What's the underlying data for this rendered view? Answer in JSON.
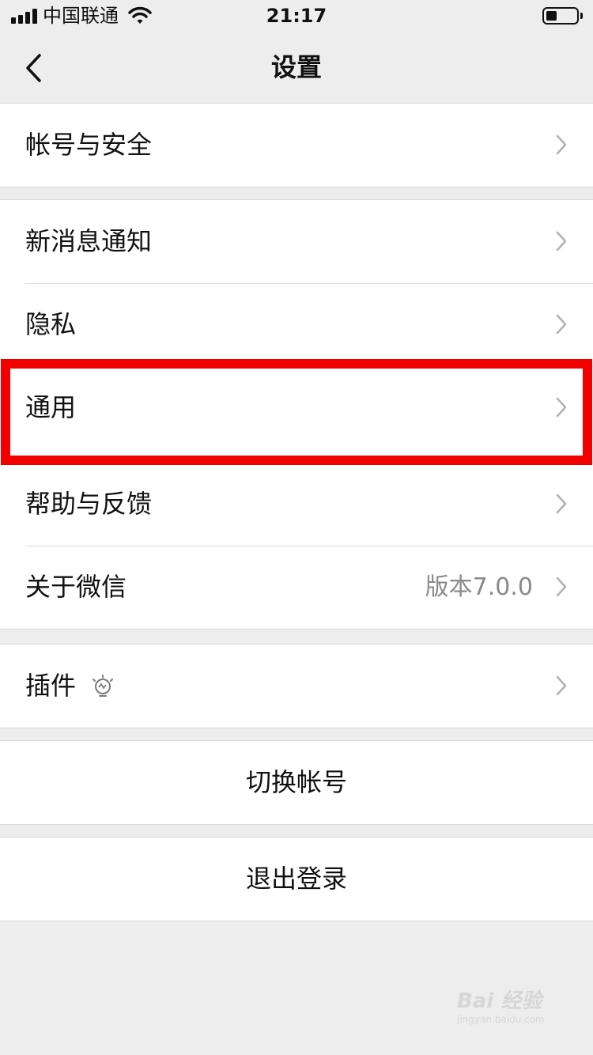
{
  "status_bar": {
    "carrier": "中国联通",
    "time": "21:17",
    "battery_level": 0.35
  },
  "nav": {
    "title": "设置"
  },
  "groups": [
    {
      "items": [
        {
          "label": "帐号与安全"
        }
      ]
    },
    {
      "items": [
        {
          "label": "新消息通知"
        },
        {
          "label": "隐私"
        },
        {
          "label": "通用",
          "highlighted": true
        },
        {
          "label": "帮助与反馈"
        },
        {
          "label": "关于微信",
          "value": "版本7.0.0"
        }
      ]
    },
    {
      "items": [
        {
          "label": "插件",
          "icon": "lightbulb-icon"
        }
      ]
    }
  ],
  "actions": {
    "switch_account": "切换帐号",
    "logout": "退出登录"
  },
  "watermark": {
    "main": "Bai 经验",
    "sub": "jingyan.baidu.com"
  },
  "colors": {
    "background": "#ededed",
    "highlight_border": "#f20000",
    "secondary_text": "#8a8a8a",
    "chevron": "#b2b2b2"
  }
}
